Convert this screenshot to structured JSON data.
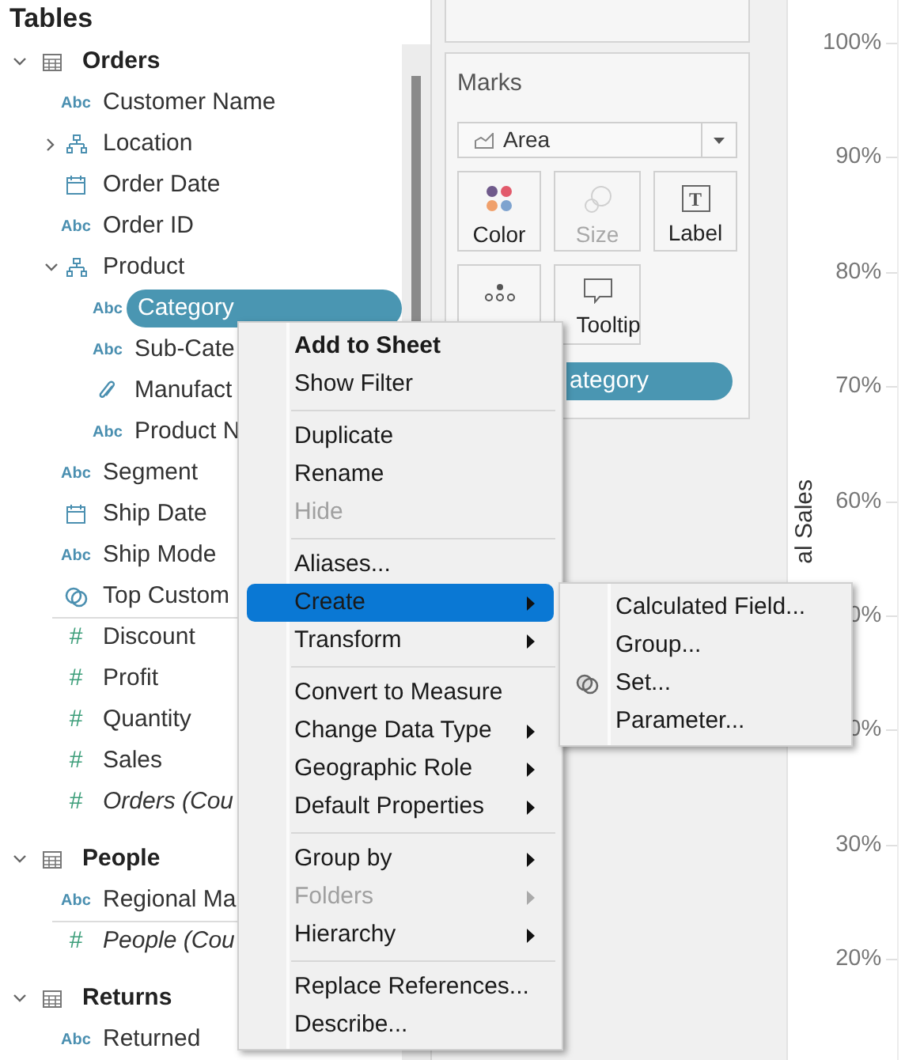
{
  "data_pane": {
    "title": "Tables",
    "tables": [
      {
        "name": "Orders",
        "expanded": true,
        "fields": [
          {
            "name": "Customer Name",
            "kind": "string",
            "type_label": "Abc",
            "selected": false
          },
          {
            "name": "Location",
            "kind": "hierarchy",
            "expanded": false,
            "selected": false
          },
          {
            "name": "Order Date",
            "kind": "date",
            "selected": false
          },
          {
            "name": "Order ID",
            "kind": "string",
            "type_label": "Abc",
            "selected": false
          },
          {
            "name": "Product",
            "kind": "hierarchy",
            "expanded": true,
            "selected": false,
            "children": [
              {
                "name": "Category",
                "kind": "string",
                "type_label": "Abc",
                "selected": true
              },
              {
                "name": "Sub-Cate",
                "kind": "string",
                "type_label": "Abc",
                "selected": false
              },
              {
                "name": "Manufact",
                "kind": "group",
                "selected": false
              },
              {
                "name": "Product N",
                "kind": "string",
                "type_label": "Abc",
                "selected": false
              }
            ]
          },
          {
            "name": "Segment",
            "kind": "string",
            "type_label": "Abc",
            "selected": false
          },
          {
            "name": "Ship Date",
            "kind": "date",
            "selected": false
          },
          {
            "name": "Ship Mode",
            "kind": "string",
            "type_label": "Abc",
            "selected": false
          },
          {
            "name": "Top Custom",
            "kind": "set",
            "selected": false
          },
          {
            "name": "Discount",
            "kind": "measure",
            "type_label": "#",
            "generated": false,
            "selected": false
          },
          {
            "name": "Profit",
            "kind": "measure",
            "type_label": "#",
            "generated": false,
            "selected": false
          },
          {
            "name": "Quantity",
            "kind": "measure",
            "type_label": "#",
            "generated": false,
            "selected": false
          },
          {
            "name": "Sales",
            "kind": "measure",
            "type_label": "#",
            "generated": false,
            "selected": false
          },
          {
            "name": "Orders (Cou",
            "kind": "measure",
            "type_label": "#",
            "generated": true,
            "selected": false
          }
        ]
      },
      {
        "name": "People",
        "expanded": true,
        "fields": [
          {
            "name": "Regional Ma",
            "kind": "string",
            "type_label": "Abc",
            "selected": false
          },
          {
            "name": "People (Cou",
            "kind": "measure",
            "type_label": "#",
            "generated": true,
            "selected": false
          }
        ]
      },
      {
        "name": "Returns",
        "expanded": true,
        "fields": [
          {
            "name": "Returned",
            "kind": "string",
            "type_label": "Abc",
            "selected": false
          }
        ]
      }
    ]
  },
  "marks": {
    "title": "Marks",
    "mark_type": "Area",
    "cards": [
      {
        "kind": "color",
        "label": "Color",
        "disabled": false
      },
      {
        "kind": "size",
        "label": "Size",
        "disabled": true
      },
      {
        "kind": "label",
        "label": "Label",
        "icon_text": "T",
        "disabled": false
      },
      {
        "kind": "detail",
        "disabled": false
      },
      {
        "kind": "tooltip",
        "label": "Tooltip",
        "disabled": false
      }
    ],
    "pill": "ategory"
  },
  "axis": {
    "title": "al Sales",
    "labels": [
      "100%",
      "90%",
      "80%",
      "70%",
      "60%",
      "0%",
      "0%",
      "30%",
      "20%"
    ]
  },
  "context_menu": {
    "items": [
      {
        "kind": "item",
        "label": "Add to Sheet",
        "bold": true,
        "disabled": false,
        "submenu": false,
        "selected": false
      },
      {
        "kind": "item",
        "label": "Show Filter",
        "bold": false,
        "disabled": false,
        "submenu": false,
        "selected": false
      },
      {
        "kind": "separator"
      },
      {
        "kind": "item",
        "label": "Duplicate",
        "bold": false,
        "disabled": false,
        "submenu": false,
        "selected": false
      },
      {
        "kind": "item",
        "label": "Rename",
        "bold": false,
        "disabled": false,
        "submenu": false,
        "selected": false
      },
      {
        "kind": "item",
        "label": "Hide",
        "bold": false,
        "disabled": true,
        "submenu": false,
        "selected": false
      },
      {
        "kind": "separator"
      },
      {
        "kind": "item",
        "label": "Aliases...",
        "bold": false,
        "disabled": false,
        "submenu": false,
        "selected": false
      },
      {
        "kind": "item",
        "label": "Create",
        "bold": false,
        "disabled": false,
        "submenu": true,
        "selected": true
      },
      {
        "kind": "item",
        "label": "Transform",
        "bold": false,
        "disabled": false,
        "submenu": true,
        "selected": false
      },
      {
        "kind": "separator"
      },
      {
        "kind": "item",
        "label": "Convert to Measure",
        "bold": false,
        "disabled": false,
        "submenu": false,
        "selected": false
      },
      {
        "kind": "item",
        "label": "Change Data Type",
        "bold": false,
        "disabled": false,
        "submenu": true,
        "selected": false
      },
      {
        "kind": "item",
        "label": "Geographic Role",
        "bold": false,
        "disabled": false,
        "submenu": true,
        "selected": false
      },
      {
        "kind": "item",
        "label": "Default Properties",
        "bold": false,
        "disabled": false,
        "submenu": true,
        "selected": false
      },
      {
        "kind": "separator"
      },
      {
        "kind": "item",
        "label": "Group by",
        "bold": false,
        "disabled": false,
        "submenu": true,
        "selected": false
      },
      {
        "kind": "item",
        "label": "Folders",
        "bold": false,
        "disabled": true,
        "submenu": true,
        "selected": false
      },
      {
        "kind": "item",
        "label": "Hierarchy",
        "bold": false,
        "disabled": false,
        "submenu": true,
        "selected": false
      },
      {
        "kind": "separator"
      },
      {
        "kind": "item",
        "label": "Replace References...",
        "bold": false,
        "disabled": false,
        "submenu": false,
        "selected": false
      },
      {
        "kind": "item",
        "label": "Describe...",
        "bold": false,
        "disabled": false,
        "submenu": false,
        "selected": false
      }
    ],
    "submenu": [
      {
        "kind": "item",
        "label": "Calculated Field..."
      },
      {
        "kind": "item",
        "label": "Group..."
      },
      {
        "kind": "set",
        "label": "Set..."
      },
      {
        "kind": "item",
        "label": "Parameter..."
      }
    ]
  }
}
